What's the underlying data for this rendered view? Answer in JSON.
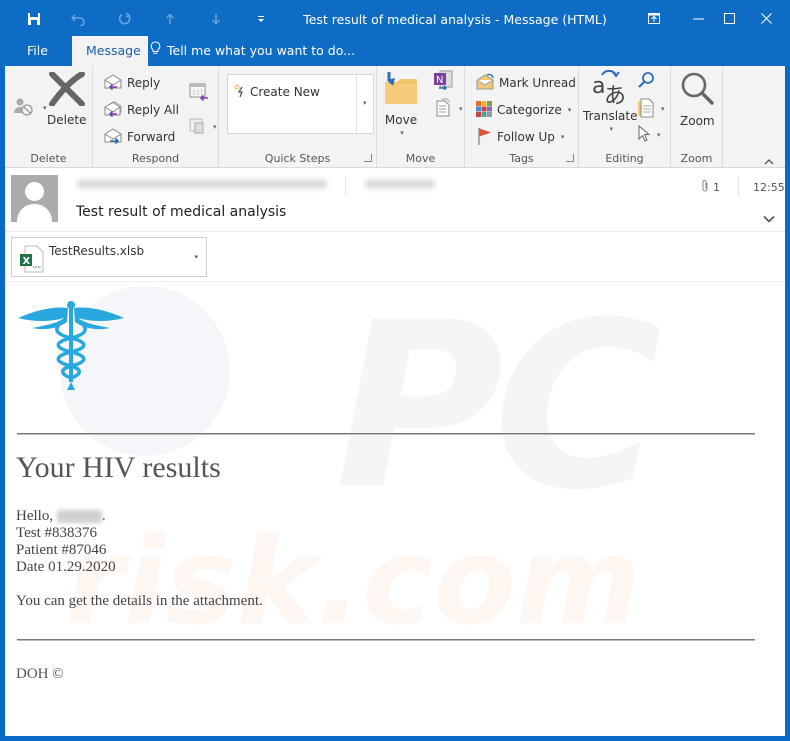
{
  "window": {
    "title": "Test result of medical analysis - Message (HTML)"
  },
  "qat": {
    "save": "save-icon",
    "undo": "undo-icon",
    "redo": "redo-icon",
    "up": "up-arrow-icon",
    "down": "down-arrow-icon",
    "customize": "customize-qat-icon"
  },
  "tabs": [
    {
      "label": "File",
      "active": false
    },
    {
      "label": "Message",
      "active": true
    }
  ],
  "tell_me": {
    "placeholder": "Tell me what you want to do..."
  },
  "ribbon": {
    "groups": {
      "delete": {
        "label": "Delete",
        "delete_button": "Delete"
      },
      "respond": {
        "label": "Respond",
        "reply": "Reply",
        "reply_all": "Reply All",
        "forward": "Forward"
      },
      "quick_steps": {
        "label": "Quick Steps",
        "create_new": "Create New"
      },
      "move": {
        "label": "Move",
        "move_button": "Move"
      },
      "tags": {
        "label": "Tags",
        "mark_unread": "Mark Unread",
        "categorize": "Categorize",
        "follow_up": "Follow Up"
      },
      "editing": {
        "label": "Editing",
        "translate": "Translate"
      },
      "zoom": {
        "label": "Zoom",
        "zoom_button": "Zoom"
      }
    }
  },
  "message": {
    "subject": "Test result of medical analysis",
    "attachment_count": "1",
    "time": "12:55",
    "attachment": {
      "filename": "TestResults.xlsb",
      "type_icon": "excel-file-icon"
    }
  },
  "body": {
    "heading": "Your HIV results",
    "greeting": "Hello,",
    "greeting_end": ".",
    "test_number": "Test #838376",
    "patient_number": "Patient #87046",
    "date": "Date 01.29.2020",
    "details": "You can get the details in the attachment.",
    "footer": "DOH ©"
  },
  "colors": {
    "title_bar": "#0f6cc4",
    "ribbon_bg": "#f3f3f3",
    "caduceus": "#29a8e0"
  }
}
